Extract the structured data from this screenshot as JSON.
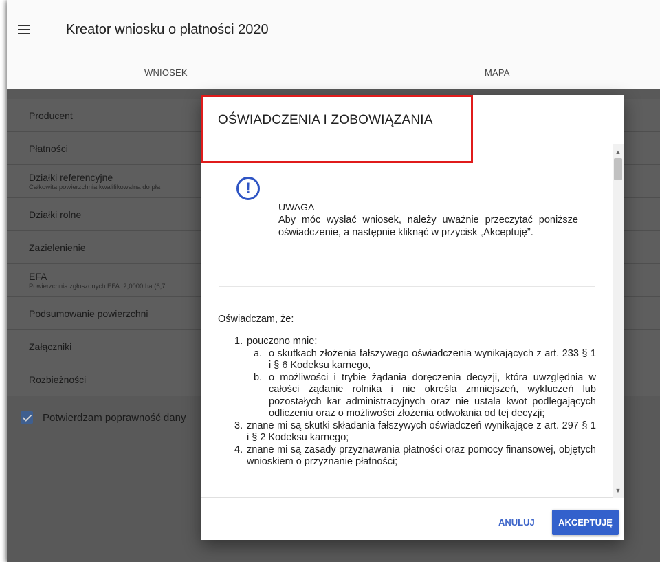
{
  "app": {
    "title": "Kreator wniosku o płatności 2020"
  },
  "tabs": [
    {
      "label": "WNIOSEK"
    },
    {
      "label": "MAPA"
    }
  ],
  "sidebar": {
    "items": [
      {
        "label": "Producent",
        "sub": ""
      },
      {
        "label": "Płatności",
        "sub": ""
      },
      {
        "label": "Działki referencyjne",
        "sub": "Całkowita powierzchnia kwalifikowalna do pła"
      },
      {
        "label": "Działki rolne",
        "sub": ""
      },
      {
        "label": "Zazielenienie",
        "sub": ""
      },
      {
        "label": "EFA",
        "sub": "Powierzchnia zgłoszonych EFA: 2,0000 ha (6,7"
      },
      {
        "label": "Podsumowanie powierzchni",
        "sub": ""
      },
      {
        "label": "Załączniki",
        "sub": ""
      },
      {
        "label": "Rozbieżności",
        "sub": ""
      }
    ],
    "confirm_label": "Potwierdzam poprawność dany",
    "confirm_checked": true
  },
  "dialog": {
    "title": "OŚWIADCZENIA I ZOBOWIĄZANIA",
    "notice": {
      "icon": "exclamation-circle-icon",
      "title": "UWAGA",
      "text": "Aby móc wysłać wniosek, należy uważnie przeczytać poniższe oświadczenie, a następnie kliknąć w przycisk „Akceptuję”."
    },
    "intro": "Oświadczam, że:",
    "terms": [
      {
        "num": "1.",
        "text": "pouczono mnie:",
        "subs": [
          {
            "num": "a.",
            "text": "o skutkach złożenia fałszywego oświadczenia wynikających z art. 233 § 1 i § 6 Kodeksu karnego,"
          },
          {
            "num": "b.",
            "text": "o możliwości i trybie żądania doręczenia decyzji, która uwzględnia w całości żądanie rolnika i nie określa zmniejszeń, wykluczeń lub pozostałych kar administracyjnych oraz nie ustala kwot podlegających odliczeniu oraz o możliwości złożenia odwołania od tej decyzji;"
          }
        ]
      },
      {
        "num": "3.",
        "text": "znane mi są skutki składania fałszywych oświadczeń wynikające z art. 297 § 1 i § 2 Kodeksu karnego;",
        "subs": []
      },
      {
        "num": "4.",
        "text": "znane mi są zasady przyznawania płatności oraz pomocy finansowej, objętych wnioskiem o przyznanie płatności;",
        "subs": []
      }
    ],
    "cancel_label": "ANULUJ",
    "accept_label": "AKCEPTUJĘ"
  },
  "colors": {
    "accent": "#3361cc",
    "highlight": "#e01b1b",
    "overlay": "#595959"
  }
}
